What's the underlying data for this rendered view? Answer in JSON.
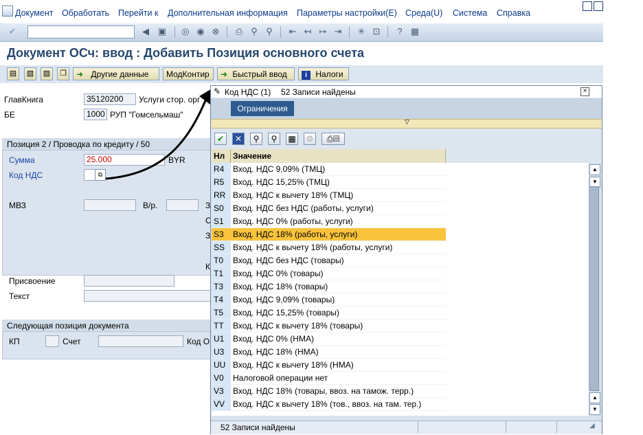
{
  "menu": [
    "Документ",
    "Обработать",
    "Перейти к",
    "Дополнительная информация",
    "Параметры настройки(E)",
    "Среда(U)",
    "Система",
    "Справка"
  ],
  "icons": {
    "toolbar": [
      "enter-check-icon",
      "save-icon",
      "back-icon",
      "exit-icon",
      "cancel-icon",
      "print-icon",
      "find-icon",
      "find-next-icon",
      "first-page-icon",
      "prev-page-icon",
      "next-page-icon",
      "last-page-icon",
      "new-session-icon",
      "shortcut-icon",
      "help-icon",
      "layout-icon"
    ],
    "popup_toolbar": [
      "accept-check-icon",
      "close-x-icon",
      "find-icon",
      "find-next-icon",
      "filter-icon",
      "settings-icon",
      "print-icon"
    ]
  },
  "title": "Документ ОСч: ввод : Добавить Позиция основного счета",
  "app_buttons": {
    "other_data": "Другие данные",
    "mod_kontir": "МодКонтир",
    "fast_entry": "Быстрый ввод",
    "taxes": "Налоги"
  },
  "header_fields": {
    "glavkniga_label": "ГлавКнига",
    "glavkniga_value": "35120200",
    "glavkniga_desc": "Услуги стор. орг",
    "be_label": "БЕ",
    "be_value": "1000",
    "be_desc": "РУП \"Гомсельмаш\""
  },
  "item_panel": {
    "header": "Позиция 2 / Проводка по кредиту / 50",
    "amount_label": "Сумма",
    "amount_value": "25.000",
    "currency": "BYR",
    "tax_code_label": "Код НДС",
    "mvz_label": "МВЗ",
    "vr_label": "В/р.",
    "assignment_label": "Присвоение",
    "text_label": "Текст",
    "cut_3": "З",
    "cut_c": "С",
    "cut_z3": "З",
    "cut_k": "К"
  },
  "next_item_panel": {
    "header": "Следующая позиция документа",
    "kp_label": "КП",
    "account_label": "Счет",
    "code_label": "Код О"
  },
  "popup": {
    "title": "Код НДС (1)",
    "found_text": "52 Записи найдены",
    "restrictions_tab": "Ограничения",
    "col_key": "Нл",
    "col_value": "Значение",
    "status_text": "52 Записи найдены",
    "rows": [
      {
        "key": "R4",
        "value": "Вход. НДС 9,09% (ТМЦ)"
      },
      {
        "key": "R5",
        "value": "Вход. НДС 15,25% (ТМЦ)"
      },
      {
        "key": "RR",
        "value": "Вход. НДС к вычету 18% (ТМЦ)"
      },
      {
        "key": "S0",
        "value": "Вход. НДС без НДС (работы, услуги)"
      },
      {
        "key": "S1",
        "value": "Вход. НДС 0% (работы, услуги)"
      },
      {
        "key": "S3",
        "value": "Вход. НДС 18% (работы, услуги)",
        "selected": true
      },
      {
        "key": "SS",
        "value": "Вход. НДС к вычету 18% (работы, услуги)"
      },
      {
        "key": "T0",
        "value": "Вход. НДС без НДС (товары)"
      },
      {
        "key": "T1",
        "value": "Вход. НДС 0% (товары)"
      },
      {
        "key": "T3",
        "value": "Вход. НДС 18% (товары)"
      },
      {
        "key": "T4",
        "value": "Вход. НДС 9,09% (товары)"
      },
      {
        "key": "T5",
        "value": "Вход. НДС 15,25% (товары)"
      },
      {
        "key": "TT",
        "value": "Вход. НДС к вычету 18% (товары)"
      },
      {
        "key": "U1",
        "value": "Вход. НДС 0% (НМА)"
      },
      {
        "key": "U3",
        "value": "Вход. НДС 18% (НМА)"
      },
      {
        "key": "UU",
        "value": "Вход. НДС к вычету 18% (НМА)"
      },
      {
        "key": "V0",
        "value": "Налоговой операции нет"
      },
      {
        "key": "V3",
        "value": "Вход. НДС 18% (товары, ввоз. на тамож. терр.)"
      },
      {
        "key": "VV",
        "value": "Вход. НДС к вычету 18% (тов., ввоз. на там. тер.)"
      }
    ]
  }
}
